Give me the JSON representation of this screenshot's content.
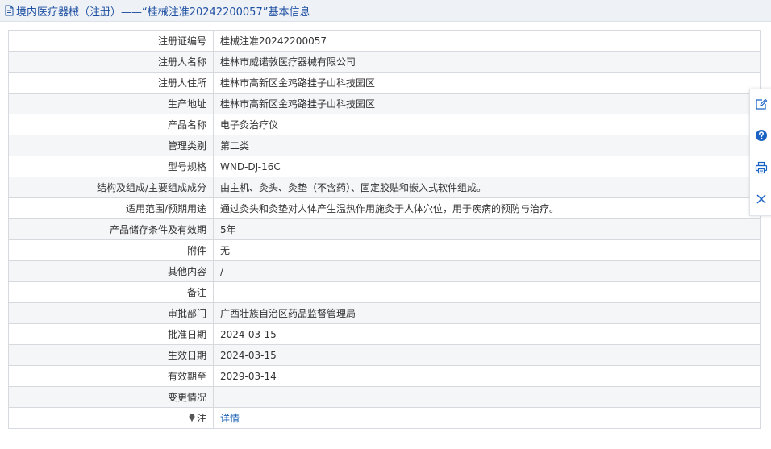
{
  "header": {
    "title": "境内医疗器械（注册）——“桂械注准20242200057”基本信息"
  },
  "rows": [
    {
      "label": "注册证编号",
      "value": "桂械注准20242200057"
    },
    {
      "label": "注册人名称",
      "value": "桂林市威诺敦医疗器械有限公司"
    },
    {
      "label": "注册人住所",
      "value": "桂林市高新区金鸡路挂子山科技园区"
    },
    {
      "label": "生产地址",
      "value": "桂林市高新区金鸡路挂子山科技园区"
    },
    {
      "label": "产品名称",
      "value": "电子灸治疗仪"
    },
    {
      "label": "管理类别",
      "value": "第二类"
    },
    {
      "label": "型号规格",
      "value": "WND-DJ-16C"
    },
    {
      "label": "结构及组成/主要组成成分",
      "value": "由主机、灸头、灸垫（不含药）、固定胶贴和嵌入式软件组成。"
    },
    {
      "label": "适用范围/预期用途",
      "value": "通过灸头和灸垫对人体产生温热作用施灸于人体穴位，用于疾病的预防与治疗。"
    },
    {
      "label": "产品储存条件及有效期",
      "value": "5年"
    },
    {
      "label": "附件",
      "value": "无"
    },
    {
      "label": "其他内容",
      "value": "/"
    },
    {
      "label": "备注",
      "value": ""
    },
    {
      "label": "审批部门",
      "value": "广西壮族自治区药品监督管理局"
    },
    {
      "label": "批准日期",
      "value": "2024-03-15"
    },
    {
      "label": "生效日期",
      "value": "2024-03-15"
    },
    {
      "label": "有效期至",
      "value": "2029-03-14"
    },
    {
      "label": "变更情况",
      "value": ""
    },
    {
      "label": "注",
      "value": "详情"
    }
  ],
  "icons": {
    "header": "document-icon",
    "note": "pin-icon",
    "toolbar": [
      "edit-icon",
      "help-icon",
      "print-icon",
      "close-icon"
    ]
  },
  "colors": {
    "header_bg": "#eef1f6",
    "header_text": "#1e50a2",
    "link": "#1e63b5",
    "border": "#d6d9de",
    "toolbar_blue": "#1a63c4"
  }
}
